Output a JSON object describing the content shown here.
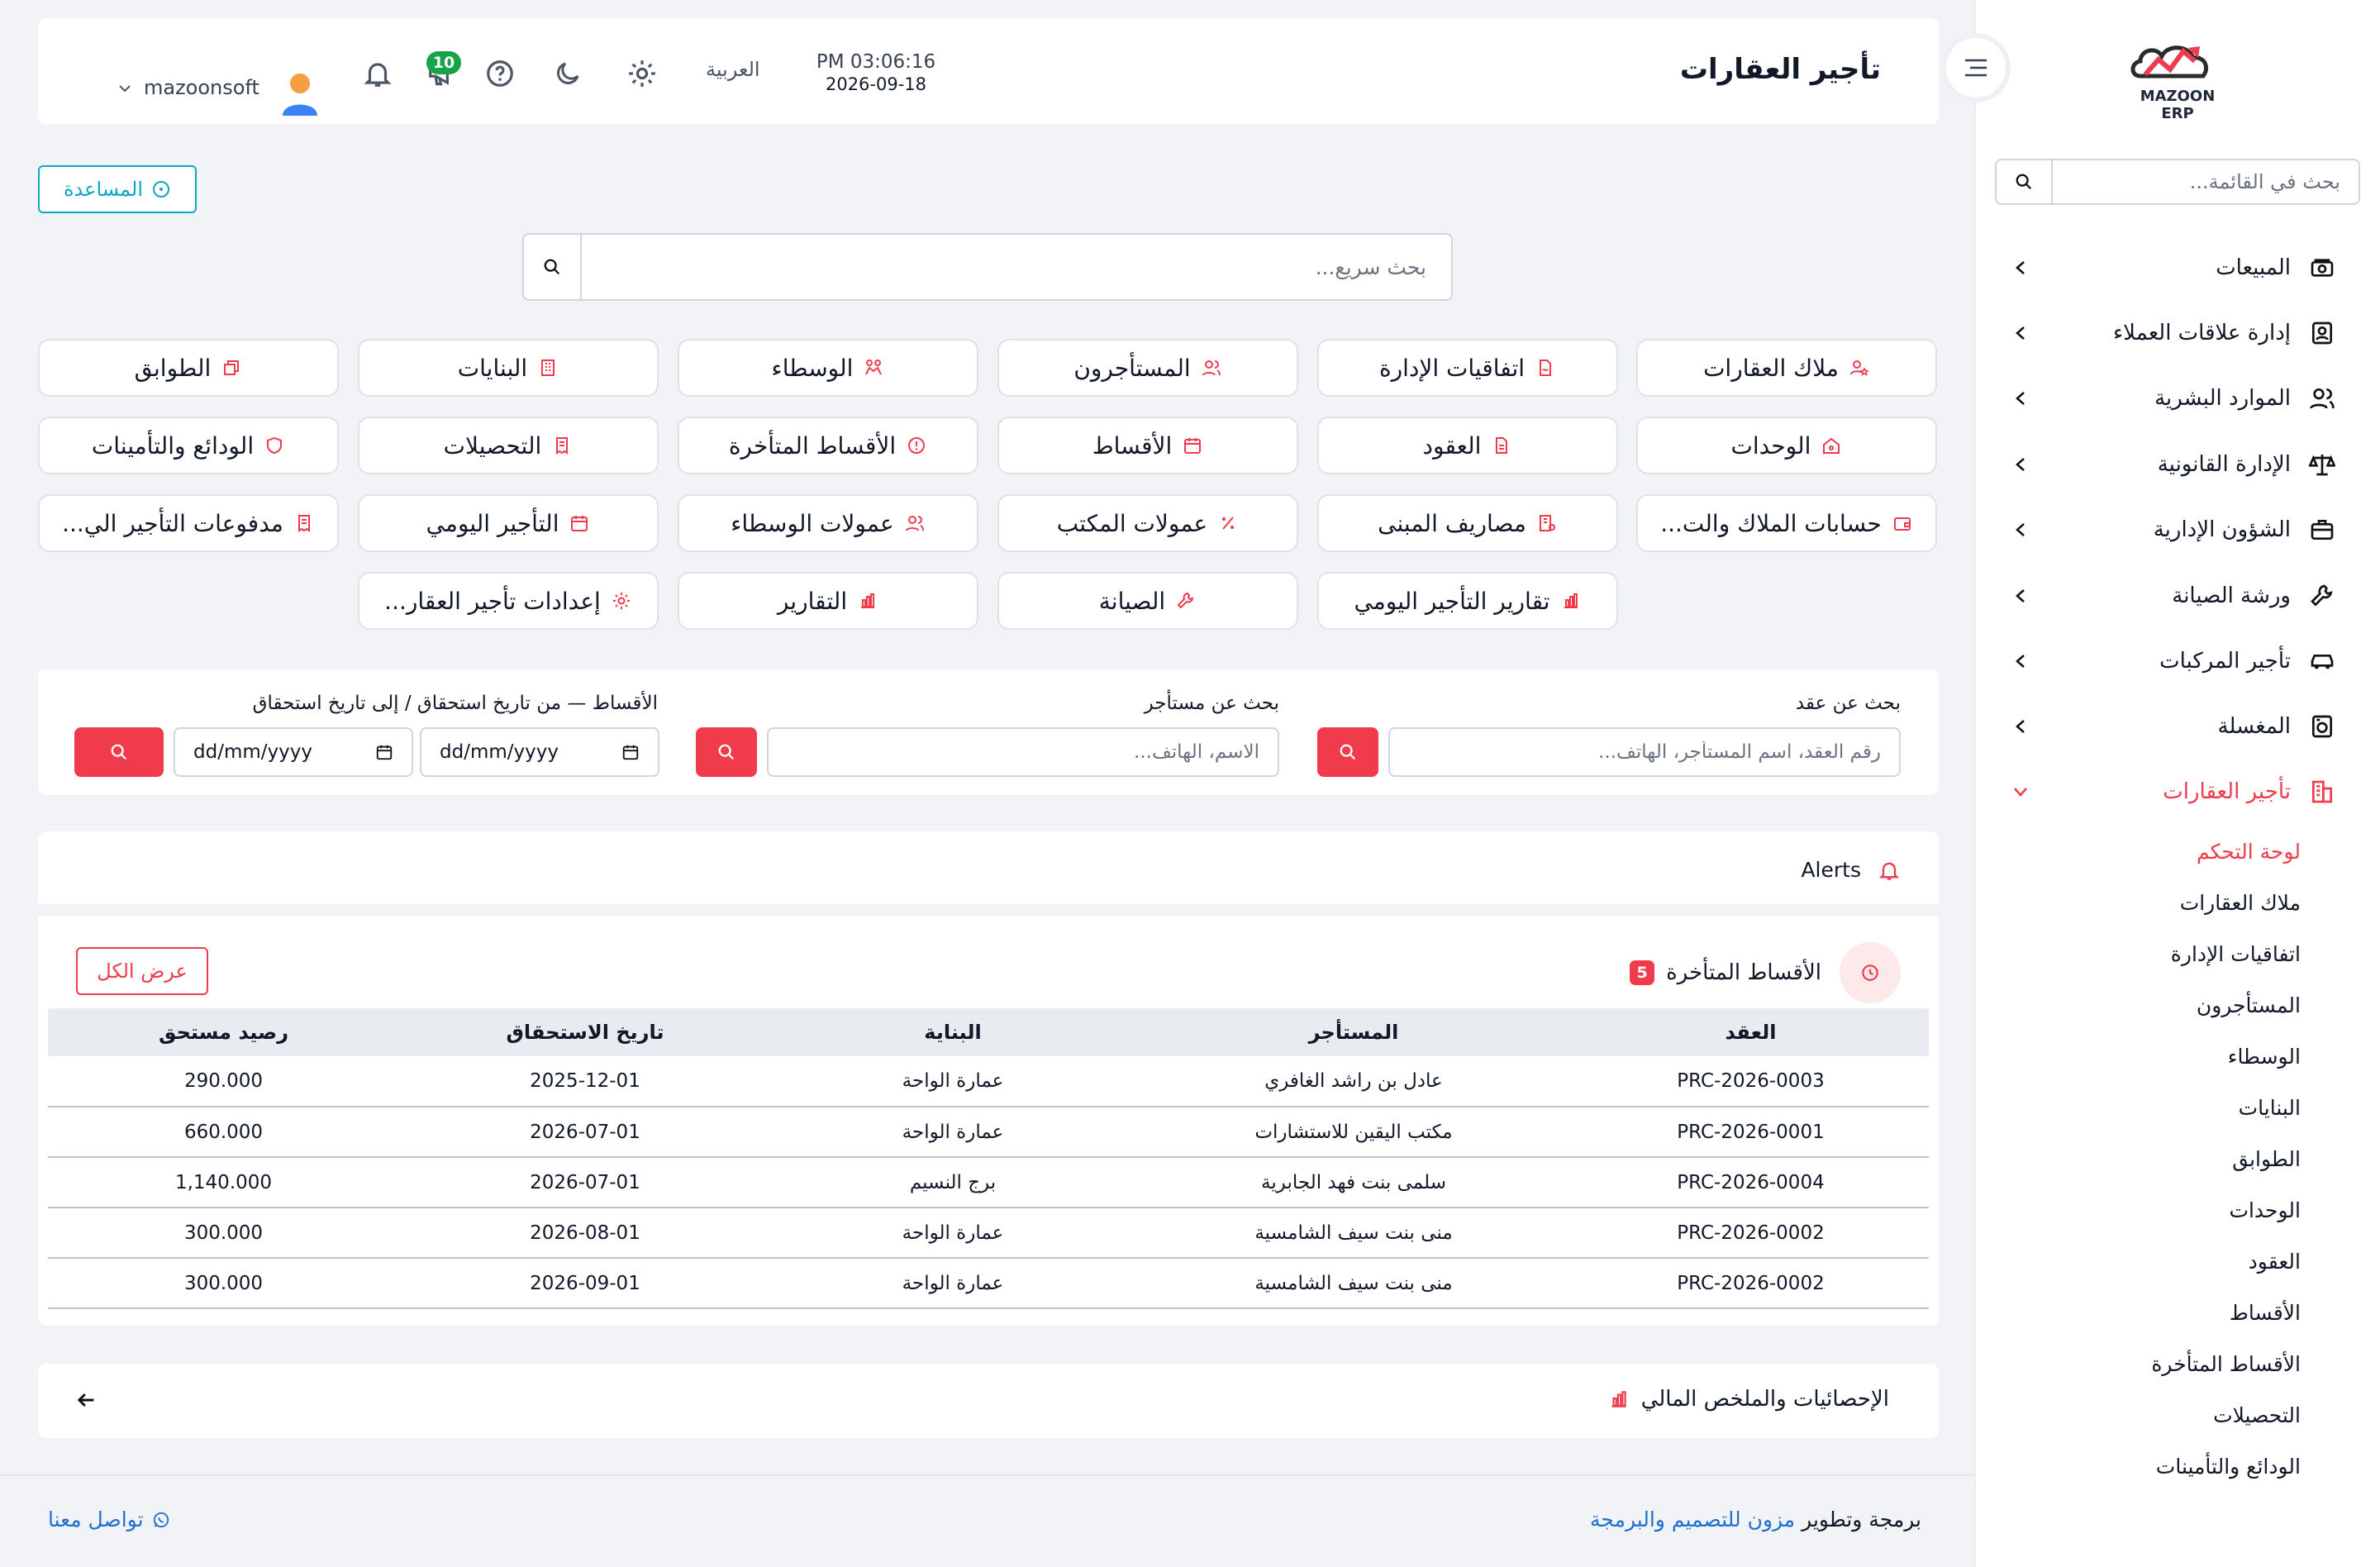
{
  "brand": {
    "logo_text": "MAZOON ERP",
    "accent": "#ef3b4b",
    "link": "#1e6fd0",
    "help_color": "#0ea5c6"
  },
  "sidebar": {
    "search_placeholder": "بحث في القائمة...",
    "items": [
      {
        "label": "المبيعات",
        "icon": "cash-register-icon"
      },
      {
        "label": "إدارة علاقات العملاء",
        "icon": "id-card-icon"
      },
      {
        "label": "الموارد البشرية",
        "icon": "users-icon"
      },
      {
        "label": "الإدارة القانونية",
        "icon": "scale-icon"
      },
      {
        "label": "الشؤون الإدارية",
        "icon": "briefcase-icon"
      },
      {
        "label": "ورشة الصيانة",
        "icon": "wrench-icon"
      },
      {
        "label": "تأجير المركبات",
        "icon": "car-icon"
      },
      {
        "label": "المغسلة",
        "icon": "washer-icon"
      },
      {
        "label": "تأجير العقارات",
        "icon": "buildings-icon",
        "active": true
      }
    ],
    "subitems": [
      "لوحة التحكم",
      "ملاك العقارات",
      "اتفاقيات الإدارة",
      "المستأجرون",
      "الوسطاء",
      "البنايات",
      "الطوابق",
      "الوحدات",
      "العقود",
      "الأقساط",
      "الأقساط المتأخرة",
      "التحصيلات",
      "الودائع والتأمينات"
    ]
  },
  "header": {
    "title": "تأجير العقارات",
    "time": "PM 03:06:16",
    "date": "2026-09-18",
    "language": "العربية",
    "notifications_count": "10",
    "username": "mazoonsoft"
  },
  "help_label": "المساعدة",
  "quick_search_placeholder": "بحث سريع...",
  "modules": [
    [
      "ملاك العقارات",
      "اتفاقيات الإدارة",
      "المستأجرون",
      "الوسطاء",
      "البنايات",
      "الطوابق"
    ],
    [
      "الوحدات",
      "العقود",
      "الأقساط",
      "الأقساط المتأخرة",
      "التحصيلات",
      "الودائع والتأمينات"
    ],
    [
      "حسابات الملاك والت...",
      "مصاريف المبنى",
      "عمولات المكتب",
      "عمولات الوسطاء",
      "التأجير اليومي",
      "مدفوعات التأجير الي..."
    ],
    [
      "تقارير التأجير اليومي",
      "الصيانة",
      "التقارير",
      "إعدادات تأجير العقار..."
    ]
  ],
  "search_panel": {
    "contract": {
      "label": "بحث عن عقد",
      "placeholder": "رقم العقد، اسم المستأجر، الهاتف..."
    },
    "tenant": {
      "label": "بحث عن مستأجر",
      "placeholder": "الاسم، الهاتف..."
    },
    "installments": {
      "label": "الأقساط — من تاريخ استحقاق / إلى تاريخ استحقاق",
      "from_placeholder": "dd/mm/yyyy",
      "to_placeholder": "dd/mm/yyyy"
    }
  },
  "alerts": {
    "title": "Alerts",
    "overdue_title": "الأقساط المتأخرة",
    "overdue_count": "5",
    "view_all": "عرض الكل",
    "columns": [
      "العقد",
      "المستأجر",
      "البناية",
      "تاريخ الاستحقاق",
      "رصيد مستحق"
    ],
    "rows": [
      [
        "PRC-2026-0003",
        "عادل بن راشد الغافري",
        "عمارة الواحة",
        "2025-12-01",
        "290.000"
      ],
      [
        "PRC-2026-0001",
        "مكتب اليقين للاستشارات",
        "عمارة الواحة",
        "2026-07-01",
        "660.000"
      ],
      [
        "PRC-2026-0004",
        "سلمى بنت فهد الجابرية",
        "برج النسيم",
        "2026-07-01",
        "1,140.000"
      ],
      [
        "PRC-2026-0002",
        "منى بنت سيف الشامسية",
        "عمارة الواحة",
        "2026-08-01",
        "300.000"
      ],
      [
        "PRC-2026-0002",
        "منى بنت سيف الشامسية",
        "عمارة الواحة",
        "2026-09-01",
        "300.000"
      ]
    ]
  },
  "stats_title": "الإحصائيات والملخص المالي",
  "footer": {
    "prefix": "برمجة وتطوير",
    "company": "مزون للتصميم والبرمجة",
    "contact": "تواصل معنا"
  }
}
